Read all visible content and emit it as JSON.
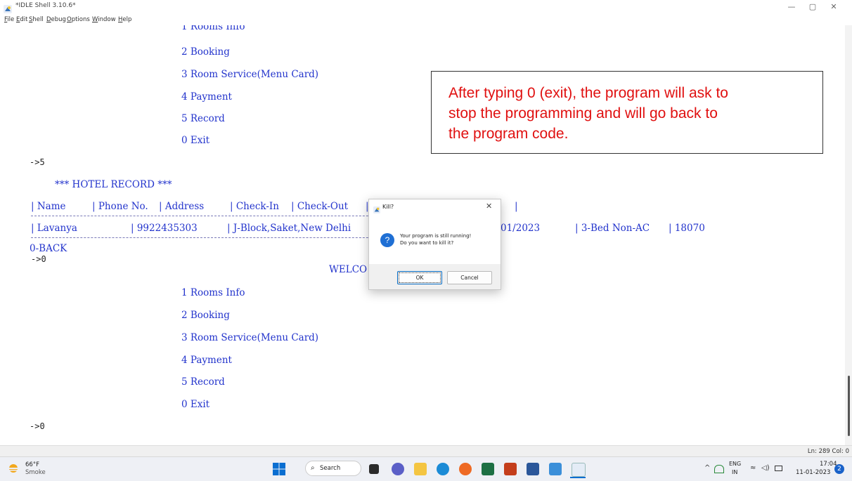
{
  "window": {
    "title": "*IDLE Shell 3.10.6*",
    "controls": {
      "minimize": "—",
      "maximize": "▢",
      "close": "✕"
    }
  },
  "menubar": [
    "File",
    "Edit",
    "Shell",
    "Debug",
    "Options",
    "Window",
    "Help"
  ],
  "shell": {
    "partial_top": "1 Rooms Info",
    "menu1": [
      "2 Booking",
      "3 Room Service(Menu Card)",
      "4 Payment",
      "5 Record",
      "0 Exit"
    ],
    "prompt1": "->5",
    "record_title": "*** HOTEL RECORD ***",
    "header_cols": [
      "| Name",
      "| Phone No.",
      "| Address",
      "| Check-In",
      "| Check-Out",
      "|",
      "|"
    ],
    "row": {
      "name": "| Lavanya",
      "phone": "| 9922435303",
      "address": "| J-Block,Saket,New Delhi",
      "checkout": "01/2023",
      "room": "| 3-Bed Non-AC",
      "amount": "| 18070"
    },
    "back": "0-BACK",
    "prompt2": "->0",
    "welcome": "WELCO",
    "menu2": [
      "1 Rooms Info",
      "2 Booking",
      "3 Room Service(Menu Card)",
      "4 Payment",
      "5 Record",
      "0 Exit"
    ],
    "prompt3": "->0"
  },
  "annotation": {
    "lines": [
      "After typing 0 (exit), the program will ask to",
      "stop the programming and will go back to",
      "the program code."
    ],
    "color": "#e01010"
  },
  "dialog": {
    "title": "Kill?",
    "message_line1": "Your program is still running!",
    "message_line2": "Do you want to kill it?",
    "ok": "OK",
    "cancel": "Cancel",
    "icon": "question-icon"
  },
  "statusbar": {
    "position": "Ln: 289  Col: 0"
  },
  "taskbar": {
    "weather_temp": "66°F",
    "weather_desc": "Smoke",
    "search": "Search",
    "lang_top": "ENG",
    "lang_bottom": "IN",
    "time": "17:04",
    "date": "11-01-2023",
    "notifications": "2"
  }
}
